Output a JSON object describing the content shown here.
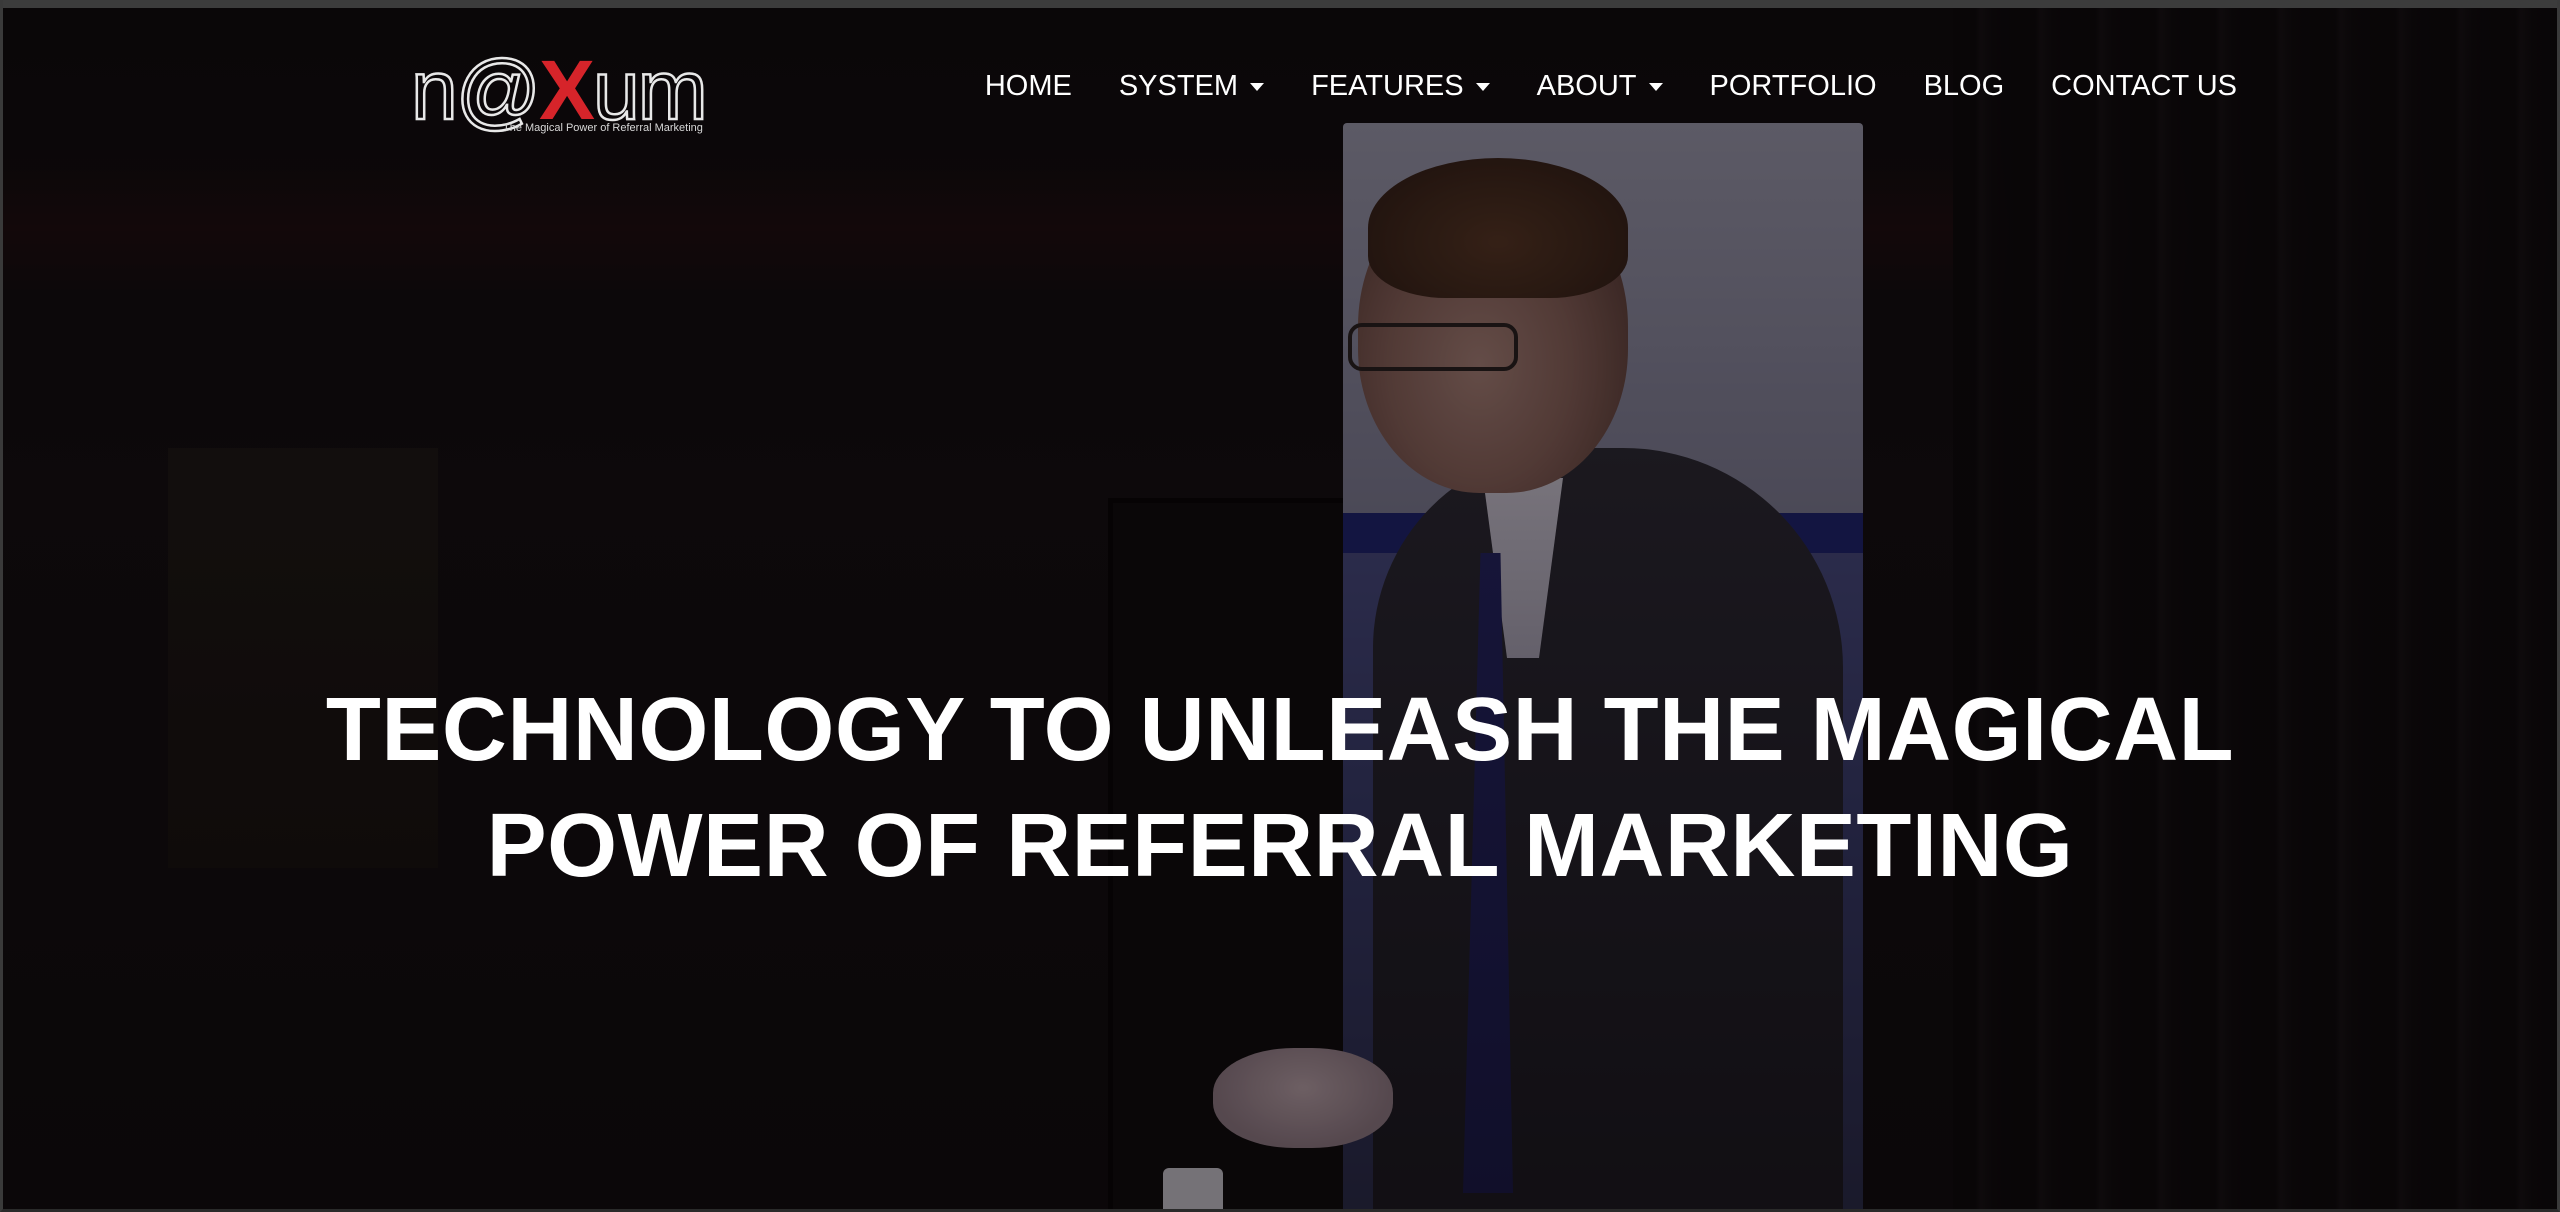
{
  "brand": {
    "logo_text_prefix": "n@",
    "logo_text_x": "X",
    "logo_text_suffix": "um",
    "logo_tagline": "The Magical Power of Referral Marketing",
    "accent_color": "#d6242a"
  },
  "nav": {
    "items": [
      {
        "label": "HOME",
        "dropdown": false
      },
      {
        "label": "SYSTEM",
        "dropdown": true
      },
      {
        "label": "FEATURES",
        "dropdown": true
      },
      {
        "label": "ABOUT",
        "dropdown": true
      },
      {
        "label": "PORTFOLIO",
        "dropdown": false
      },
      {
        "label": "BLOG",
        "dropdown": false
      },
      {
        "label": "CONTACT US",
        "dropdown": false
      }
    ],
    "caret_icon": "caret-down-icon"
  },
  "hero": {
    "headline_line1": "TECHNOLOGY TO UNLEASH THE MAGICAL",
    "headline_line2": "POWER OF REFERRAL MARKETING",
    "background": "video still of a speaker in a suit on stage in front of a roll-up banner"
  }
}
